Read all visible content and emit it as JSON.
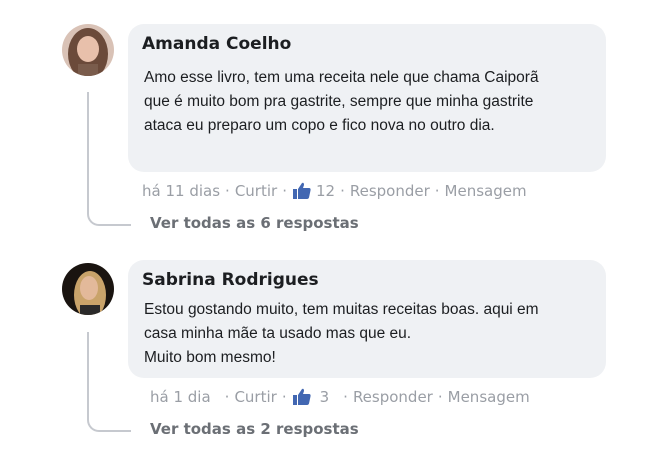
{
  "comments": [
    {
      "author": "Amanda Coelho",
      "lines": [
        "Amo esse livro, tem uma receita nele que chama Caiporã",
        "que é muito bom pra gastrite, sempre que minha gastrite",
        "ataca eu preparo um copo e fico nova no outro dia."
      ],
      "time": "há 11 dias",
      "like_label": "Curtir",
      "like_count": "12",
      "reply_label": "Responder",
      "message_label": "Mensagem",
      "see_all": "Ver todas as 6 respostas",
      "avatar_colors": {
        "bg": "#c9a79a",
        "hair": "#6b4a3a",
        "skin": "#e8c0ab"
      }
    },
    {
      "author": "Sabrina Rodrigues",
      "lines": [
        "Estou gostando muito, tem muitas receitas boas. aqui em",
        "casa minha mãe ta usado mas que eu.",
        "Muito bom mesmo!"
      ],
      "time": "há 1 dia",
      "like_label": "Curtir",
      "like_count": "3",
      "reply_label": "Responder",
      "message_label": "Mensagem",
      "see_all": "Ver todas as 2 respostas",
      "avatar_colors": {
        "bg": "#1a1410",
        "hair": "#c9a36a",
        "skin": "#e3b99a"
      }
    }
  ],
  "colors": {
    "bubble": "#eff1f4",
    "meta": "#9a9ea5",
    "like_blue": "#4267b2"
  },
  "icons": {
    "like": "thumbs-up-icon"
  }
}
